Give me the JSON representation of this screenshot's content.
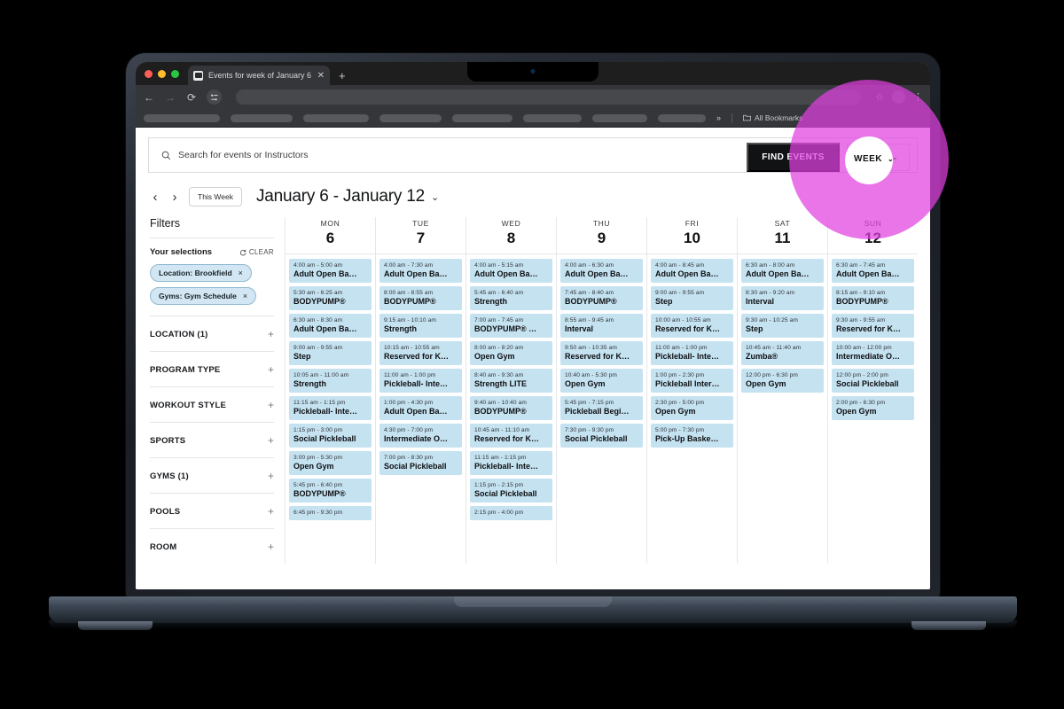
{
  "browser": {
    "tab_title": "Events for week of January 6",
    "tab_close_icon": "close-icon",
    "new_tab_icon": "+",
    "back_icon": "←",
    "forward_icon": "→",
    "reload_icon": "⟳",
    "bookmark_star_icon": "☆",
    "menu_icon": "⋮",
    "bookmarks_overflow": "»",
    "all_bookmarks_label": "All Bookmarks",
    "window_chevron": "⌄"
  },
  "search": {
    "placeholder": "Search for events or Instructors",
    "icon": "search-icon",
    "find_events_label": "FIND EVENTS",
    "week_label": "WEEK",
    "week_chevron": "⌄"
  },
  "datebar": {
    "prev_icon": "‹",
    "next_icon": "›",
    "this_week_label": "This Week",
    "range_label": "January 6 - January 12",
    "range_chevron": "⌄"
  },
  "sidebar": {
    "title": "Filters",
    "selections_label": "Your selections",
    "clear_label": "CLEAR",
    "clear_icon": "refresh-icon",
    "chips": [
      {
        "label": "Location: Brookfield",
        "remove_icon": "×"
      },
      {
        "label": "Gyms: Gym Schedule",
        "remove_icon": "×"
      }
    ],
    "facets": [
      {
        "label": "LOCATION (1)",
        "toggle": "+"
      },
      {
        "label": "PROGRAM TYPE",
        "toggle": "+"
      },
      {
        "label": "WORKOUT STYLE",
        "toggle": "+"
      },
      {
        "label": "SPORTS",
        "toggle": "+"
      },
      {
        "label": "GYMS (1)",
        "toggle": "+"
      },
      {
        "label": "POOLS",
        "toggle": "+"
      },
      {
        "label": "ROOM",
        "toggle": "+"
      }
    ]
  },
  "calendar": {
    "days": [
      {
        "dow": "MON",
        "num": "6",
        "events": [
          {
            "time": "4:00 am - 5:00 am",
            "name": "Adult Open Ba…"
          },
          {
            "time": "5:30 am - 6:25 am",
            "name": "BODYPUMP®"
          },
          {
            "time": "6:30 am - 8:30 am",
            "name": "Adult Open Ba…"
          },
          {
            "time": "9:00 am - 9:55 am",
            "name": "Step"
          },
          {
            "time": "10:05 am - 11:00 am",
            "name": "Strength"
          },
          {
            "time": "11:15 am - 1:15 pm",
            "name": "Pickleball- Inte…"
          },
          {
            "time": "1:15 pm - 3:00 pm",
            "name": "Social Pickleball"
          },
          {
            "time": "3:00 pm - 5:30 pm",
            "name": "Open Gym"
          },
          {
            "time": "5:45 pm - 6:40 pm",
            "name": "BODYPUMP®"
          },
          {
            "time": "6:45 pm - 9:30 pm",
            "name": ""
          }
        ]
      },
      {
        "dow": "TUE",
        "num": "7",
        "events": [
          {
            "time": "4:00 am - 7:30 am",
            "name": "Adult Open Ba…"
          },
          {
            "time": "8:00 am - 8:55 am",
            "name": "BODYPUMP®"
          },
          {
            "time": "9:15 am - 10:10 am",
            "name": "Strength"
          },
          {
            "time": "10:15 am - 10:55 am",
            "name": "Reserved for K…"
          },
          {
            "time": "11:00 am - 1:00 pm",
            "name": "Pickleball- Inte…"
          },
          {
            "time": "1:00 pm - 4:30 pm",
            "name": "Adult Open Ba…"
          },
          {
            "time": "4:30 pm - 7:00 pm",
            "name": "Intermediate O…"
          },
          {
            "time": "7:00 pm - 8:30 pm",
            "name": "Social Pickleball"
          }
        ]
      },
      {
        "dow": "WED",
        "num": "8",
        "events": [
          {
            "time": "4:00 am - 5:15 am",
            "name": "Adult Open Ba…"
          },
          {
            "time": "5:45 am - 6:40 am",
            "name": "Strength"
          },
          {
            "time": "7:00 am - 7:45 am",
            "name": "BODYPUMP® …"
          },
          {
            "time": "8:00 am - 8:20 am",
            "name": "Open Gym"
          },
          {
            "time": "8:40 am - 9:30 am",
            "name": "Strength LITE"
          },
          {
            "time": "9:40 am - 10:40 am",
            "name": "BODYPUMP®"
          },
          {
            "time": "10:45 am - 11:10 am",
            "name": "Reserved for K…"
          },
          {
            "time": "11:15 am - 1:15 pm",
            "name": "Pickleball- Inte…"
          },
          {
            "time": "1:15 pm - 2:15 pm",
            "name": "Social Pickleball"
          },
          {
            "time": "2:15 pm - 4:00 pm",
            "name": ""
          }
        ]
      },
      {
        "dow": "THU",
        "num": "9",
        "events": [
          {
            "time": "4:00 am - 6:30 am",
            "name": "Adult Open Ba…"
          },
          {
            "time": "7:45 am - 8:40 am",
            "name": "BODYPUMP®"
          },
          {
            "time": "8:55 am - 9:45 am",
            "name": "Interval"
          },
          {
            "time": "9:50 am - 10:35 am",
            "name": "Reserved for K…"
          },
          {
            "time": "10:40 am - 5:30 pm",
            "name": "Open Gym"
          },
          {
            "time": "5:45 pm - 7:15 pm",
            "name": "Pickleball Begi…"
          },
          {
            "time": "7:30 pm - 9:30 pm",
            "name": "Social Pickleball"
          }
        ]
      },
      {
        "dow": "FRI",
        "num": "10",
        "events": [
          {
            "time": "4:00 am - 8:45 am",
            "name": "Adult Open Ba…"
          },
          {
            "time": "9:00 am - 9:55 am",
            "name": "Step"
          },
          {
            "time": "10:00 am - 10:55 am",
            "name": "Reserved for K…"
          },
          {
            "time": "11:00 am - 1:00 pm",
            "name": "Pickleball- Inte…"
          },
          {
            "time": "1:00 pm - 2:30 pm",
            "name": "Pickleball Inter…"
          },
          {
            "time": "2:30 pm - 5:00 pm",
            "name": "Open Gym"
          },
          {
            "time": "5:00 pm - 7:30 pm",
            "name": "Pick-Up Baske…"
          }
        ]
      },
      {
        "dow": "SAT",
        "num": "11",
        "events": [
          {
            "time": "6:30 am - 8:00 am",
            "name": "Adult Open Ba…"
          },
          {
            "time": "8:30 am - 9:20 am",
            "name": "Interval"
          },
          {
            "time": "9:30 am - 10:25 am",
            "name": "Step"
          },
          {
            "time": "10:45 am - 11:40 am",
            "name": "Zumba®"
          },
          {
            "time": "12:00 pm - 6:30 pm",
            "name": "Open Gym"
          }
        ]
      },
      {
        "dow": "SUN",
        "num": "12",
        "events": [
          {
            "time": "6:30 am - 7:45 am",
            "name": "Adult Open Ba…"
          },
          {
            "time": "8:15 am - 9:10 am",
            "name": "BODYPUMP®"
          },
          {
            "time": "9:30 am - 9:55 am",
            "name": "Reserved for K…"
          },
          {
            "time": "10:00 am - 12:00 pm",
            "name": "Intermediate O…"
          },
          {
            "time": "12:00 pm - 2:00 pm",
            "name": "Social Pickleball"
          },
          {
            "time": "2:00 pm - 6:30 pm",
            "name": "Open Gym"
          }
        ]
      }
    ]
  },
  "highlight": {
    "ring_color": "#e040e0",
    "target": "WEEK",
    "target_chevron": "⌄"
  }
}
